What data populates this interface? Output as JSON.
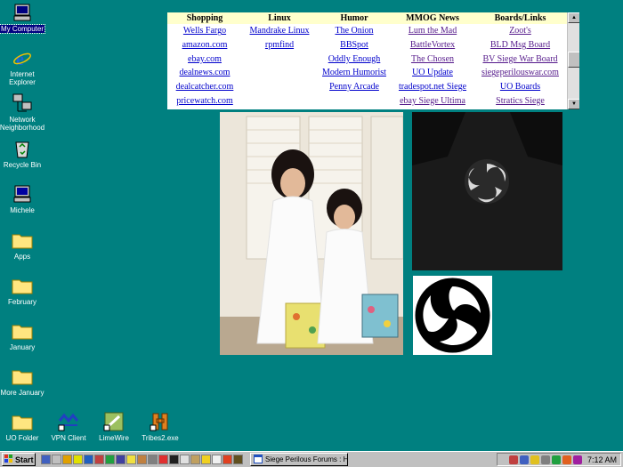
{
  "desktop": {
    "icons": [
      {
        "name": "my-computer",
        "label": "My Computer"
      },
      {
        "name": "internet-explorer",
        "label": "Internet\nExplorer"
      },
      {
        "name": "network-neighborhood",
        "label": "Network\nNeighborhood"
      },
      {
        "name": "recycle-bin",
        "label": "Recycle Bin"
      },
      {
        "name": "michele",
        "label": "Michele"
      },
      {
        "name": "apps",
        "label": "Apps"
      },
      {
        "name": "february",
        "label": "February"
      },
      {
        "name": "january",
        "label": "January"
      },
      {
        "name": "more-january",
        "label": "More January"
      },
      {
        "name": "uo-folder",
        "label": "UO Folder"
      },
      {
        "name": "vpn-client",
        "label": "VPN Client"
      },
      {
        "name": "limewire",
        "label": "LimeWire"
      },
      {
        "name": "tribes2",
        "label": "Tribes2.exe"
      }
    ]
  },
  "links": {
    "headers": [
      "Shopping",
      "Linux",
      "Humor",
      "MMOG News",
      "Boards/Links"
    ],
    "rows": [
      [
        "Wells Fargo",
        "Mandrake Linux",
        "The Onion",
        "Lum the Mad",
        "Zoot's"
      ],
      [
        "amazon.com",
        "rpmfind",
        "BBSpot",
        "BattleVortex",
        "BLD Msg Board"
      ],
      [
        "ebay.com",
        "",
        "Oddly Enough",
        "The Chosen",
        "BV Siege War Board"
      ],
      [
        "dealnews.com",
        "",
        "Modern Humorist",
        "UO Update",
        "siegeperilouswar.com"
      ],
      [
        "dealcatcher.com",
        "",
        "Penny Arcade",
        "tradespot.net Siege",
        "UO Boards"
      ],
      [
        "pricewatch.com",
        "",
        "",
        "ebay Siege Ultima",
        "Stratics Siege"
      ]
    ]
  },
  "taskbar": {
    "start_label": "Start",
    "task_label": "Siege Perilous Forums : Ha...",
    "clock": "7:12 AM"
  }
}
